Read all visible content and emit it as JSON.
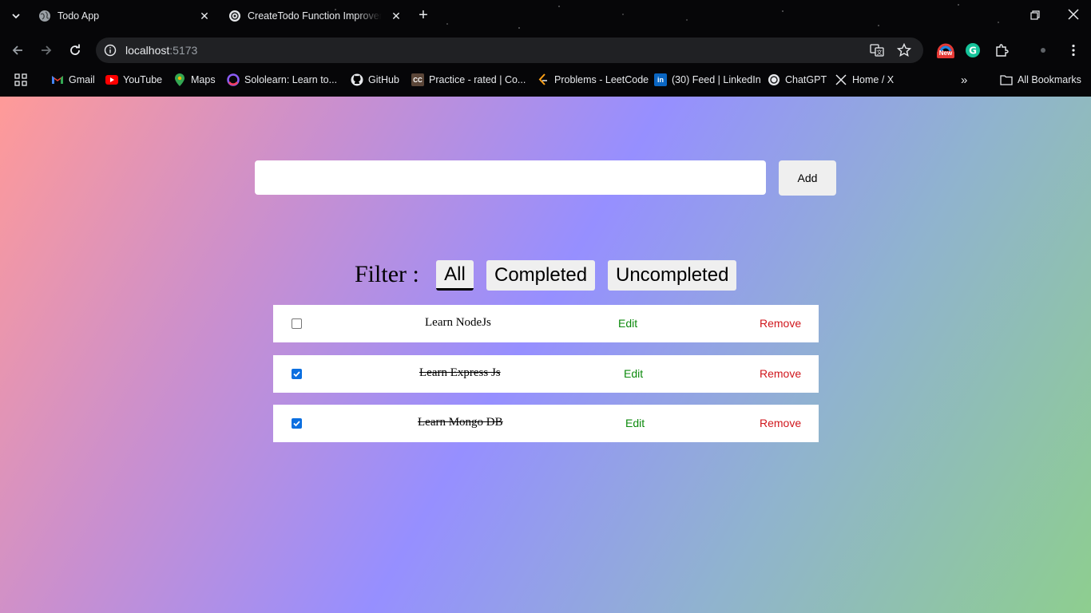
{
  "browser": {
    "tabs": [
      {
        "title": "Todo App"
      },
      {
        "title": "CreateTodo Function Improvem"
      }
    ],
    "address": {
      "host": "localhost",
      "port": ":5173"
    },
    "extension_badge": "New",
    "bookmarks": [
      {
        "label": "Gmail",
        "icon": "gmail-icon"
      },
      {
        "label": "YouTube",
        "icon": "youtube-icon"
      },
      {
        "label": "Maps",
        "icon": "maps-icon"
      },
      {
        "label": "Sololearn: Learn to...",
        "icon": "sololearn-icon"
      },
      {
        "label": "GitHub",
        "icon": "github-icon"
      },
      {
        "label": "Practice - rated | Co...",
        "icon": "codechef-icon"
      },
      {
        "label": "Problems - LeetCode",
        "icon": "leetcode-icon"
      },
      {
        "label": "(30) Feed | LinkedIn",
        "icon": "linkedin-icon"
      },
      {
        "label": "ChatGPT",
        "icon": "chatgpt-icon"
      },
      {
        "label": "Home / X",
        "icon": "x-icon"
      }
    ],
    "all_bookmarks": "All Bookmarks"
  },
  "app": {
    "input_value": "",
    "add_label": "Add",
    "filter_label": "Filter :",
    "filters": [
      "All",
      "Completed",
      "Uncompleted"
    ],
    "active_filter": "All",
    "todos": [
      {
        "text": "Learn NodeJs",
        "completed": false,
        "edit": "Edit",
        "remove": "Remove"
      },
      {
        "text": "Learn Express Js",
        "completed": true,
        "edit": "Edit",
        "remove": "Remove"
      },
      {
        "text": "Learn Mongo DB",
        "completed": true,
        "edit": "Edit",
        "remove": "Remove"
      }
    ]
  },
  "colors": {
    "edit": "#0c8a0c",
    "remove": "#d0161c",
    "checkbox": "#0b6fe0"
  }
}
